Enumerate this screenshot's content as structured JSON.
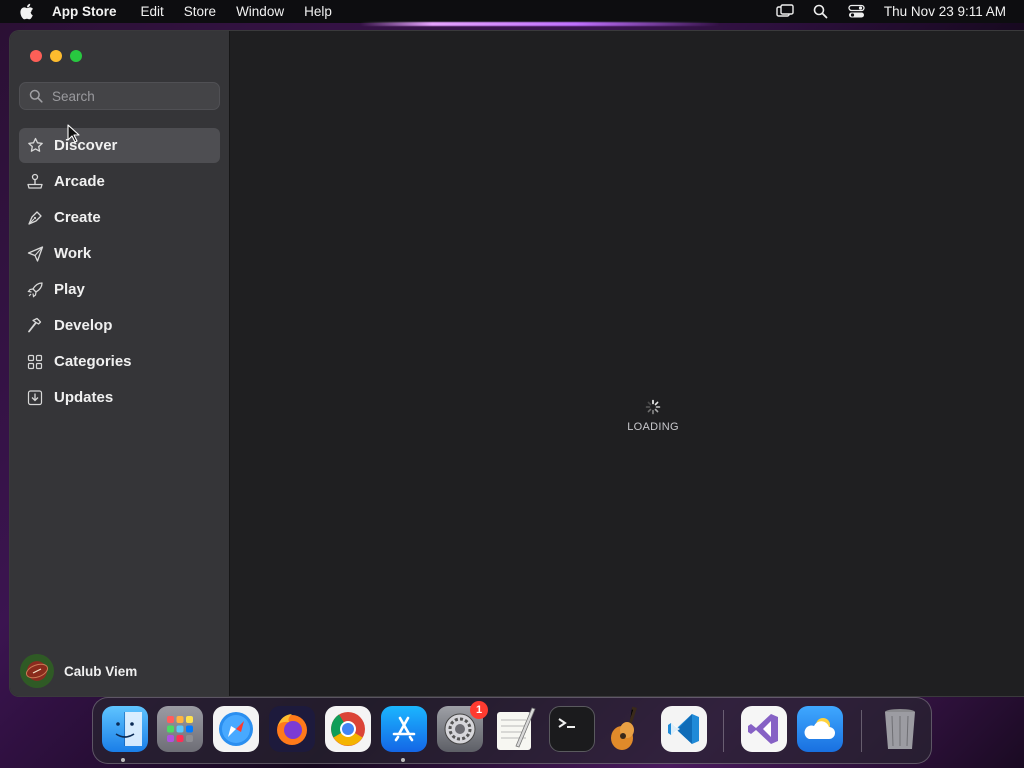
{
  "menubar": {
    "app_name": "App Store",
    "items": [
      "Edit",
      "Store",
      "Window",
      "Help"
    ],
    "clock": "Thu Nov 23  9:11 AM"
  },
  "sidebar": {
    "search_placeholder": "Search",
    "items": [
      {
        "label": "Discover",
        "icon": "star-icon",
        "active": true
      },
      {
        "label": "Arcade",
        "icon": "joystick-icon"
      },
      {
        "label": "Create",
        "icon": "pen-nib-icon"
      },
      {
        "label": "Work",
        "icon": "paper-plane-icon"
      },
      {
        "label": "Play",
        "icon": "rocket-icon"
      },
      {
        "label": "Develop",
        "icon": "hammer-icon"
      },
      {
        "label": "Categories",
        "icon": "grid-icon"
      },
      {
        "label": "Updates",
        "icon": "download-tray-icon"
      }
    ],
    "user_name": "Calub Viem"
  },
  "main": {
    "loading_label": "LOADING"
  },
  "dock": {
    "apps": [
      "Finder",
      "Launchpad",
      "Safari",
      "Firefox",
      "Chrome",
      "App Store",
      "System Settings",
      "TextEdit",
      "Terminal",
      "GarageBand",
      "Visual Studio Code",
      "Visual Studio",
      "Weather",
      "Trash"
    ],
    "system_settings_badge": "1"
  },
  "colors": {
    "close": "#fe5f57",
    "minimize": "#febc2e",
    "maximize": "#28c840",
    "sidebar_bg": "#353538",
    "content_bg": "#1f1f21",
    "active_item_bg": "#4e4e52",
    "badge": "#ff3b30"
  }
}
